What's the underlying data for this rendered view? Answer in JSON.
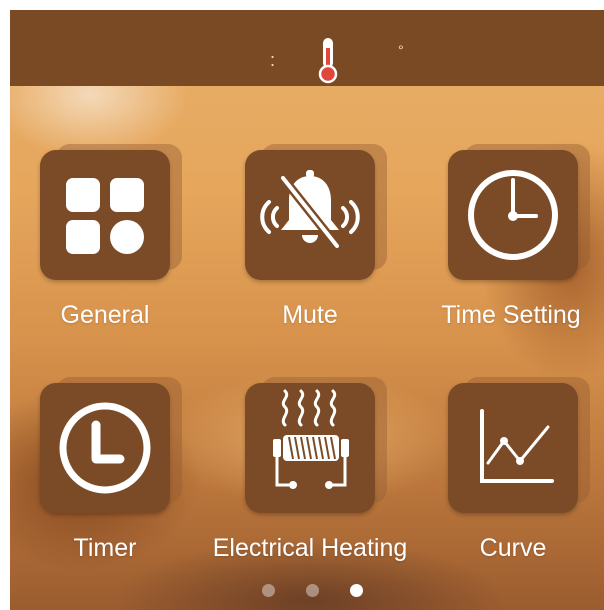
{
  "status_bar": {
    "time_separator": ":",
    "degree_symbol": "°",
    "thermometer_icon": "thermometer-icon"
  },
  "menu_items": [
    {
      "label": "General",
      "icon": "grid-icon"
    },
    {
      "label": "Mute",
      "icon": "bell-muted-icon"
    },
    {
      "label": "Time Setting",
      "icon": "clock-icon"
    },
    {
      "label": "Timer",
      "icon": "timer-icon"
    },
    {
      "label": "Electrical Heating",
      "icon": "heater-icon"
    },
    {
      "label": "Curve",
      "icon": "line-chart-icon"
    }
  ],
  "pagination": {
    "total": 3,
    "active_index": 2
  },
  "colors": {
    "top_bar": "#7a4a24",
    "tile": "#7a4b26",
    "thermometer_bulb": "#e0463c",
    "label_text": "#ffffff"
  }
}
